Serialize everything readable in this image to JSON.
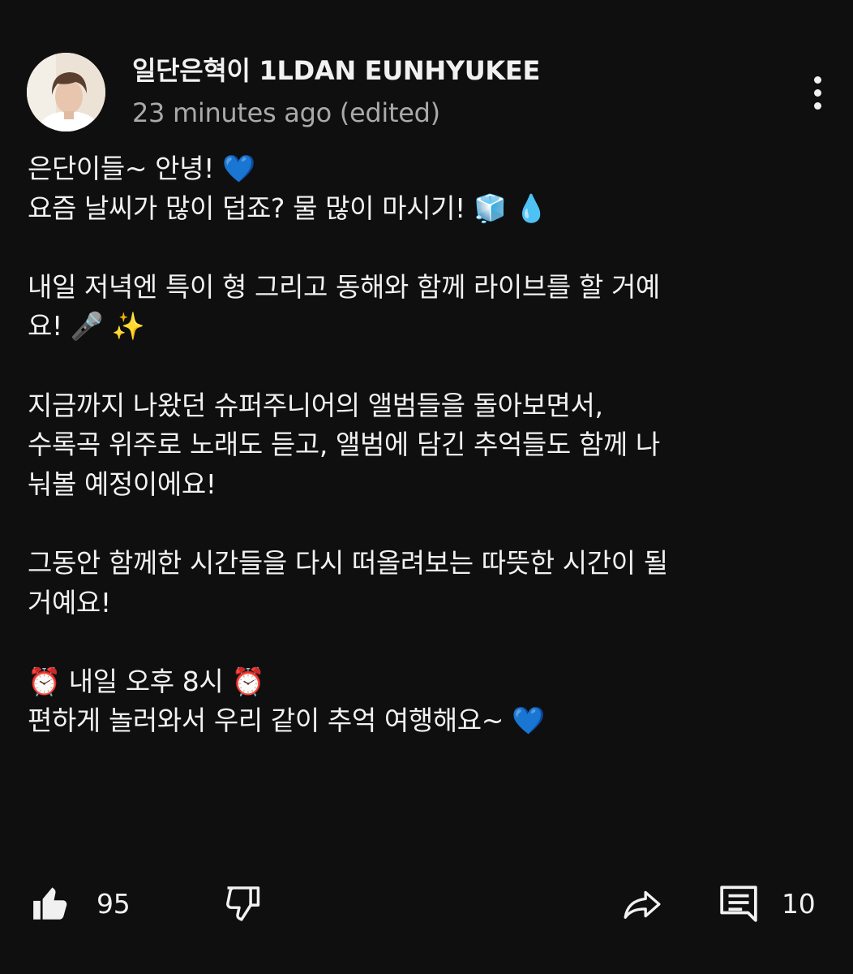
{
  "post": {
    "author": "일단은혁이 1LDAN EUNHYUKEE",
    "timestamp": "23 minutes ago (edited)",
    "more_icon": "more-vertical-icon",
    "body_lines": [
      "은단이들~ 안녕! 💙",
      "요즘 날씨가 많이 덥죠? 물 많이 마시기! 🧊 💧",
      "",
      "내일 저녁엔 특이 형 그리고 동해와 함께 라이브를 할 거예",
      "요! 🎤 ✨",
      "",
      "지금까지 나왔던 슈퍼주니어의 앨범들을 돌아보면서,",
      "수록곡 위주로 노래도 듣고, 앨범에 담긴 추억들도 함께 나",
      "눠볼 예정이에요!",
      "",
      "그동안 함께한 시간들을 다시 떠올려보는 따뜻한 시간이 될",
      "거예요!",
      "",
      "⏰ 내일 오후 8시 ⏰",
      "편하게 놀러와서 우리 같이 추억 여행해요~ 💙"
    ]
  },
  "actions": {
    "like_count": "95",
    "comment_count": "10"
  },
  "colors": {
    "background": "#0f0f0f",
    "text": "#f1f1f1",
    "secondary_text": "#aaaaaa"
  }
}
